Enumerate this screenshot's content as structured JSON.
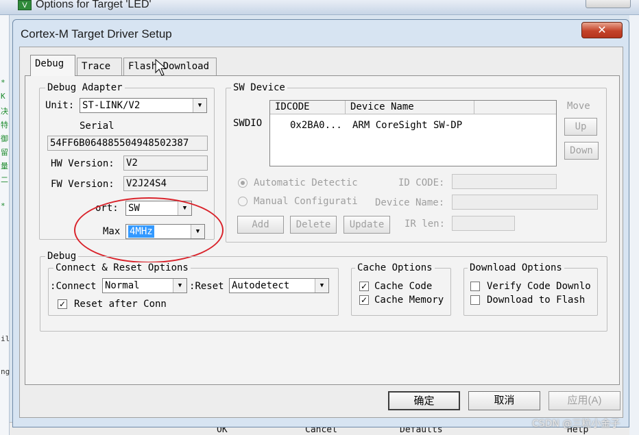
{
  "outer_window": {
    "title": "Options for Target 'LED'",
    "close_glyph": "✕",
    "side_marks": [
      "*",
      "K",
      "决",
      "特",
      "御",
      "留",
      "量",
      "二",
      "*"
    ],
    "bottom_buttons": {
      "ok": "OK",
      "cancel": "Cancel",
      "defaults": "Defaults",
      "help": "Help"
    },
    "left_fragments": [
      "il",
      "ng"
    ]
  },
  "dialog": {
    "title": "Cortex-M Target Driver Setup",
    "close_glyph": "✕",
    "tabs": [
      {
        "label": "Debug",
        "active": true
      },
      {
        "label": "Trace",
        "active": false
      },
      {
        "label": "Flash Download",
        "active": false
      }
    ]
  },
  "debug_adapter": {
    "group_label": "Debug Adapter",
    "unit_label": "Unit:",
    "unit_value": "ST-LINK/V2",
    "serial_label": "Serial",
    "serial_value": "54FF6B064885504948502387",
    "hw_label": "HW Version:",
    "hw_value": "V2",
    "fw_label": "FW Version:",
    "fw_value": "V2J24S4",
    "port_label": "ort:",
    "port_value": "SW",
    "max_label": "Max",
    "max_value": "4MHz"
  },
  "sw_device": {
    "group_label": "SW Device",
    "swdio_label": "SWDIO",
    "columns": [
      "IDCODE",
      "Device Name"
    ],
    "rows": [
      {
        "idcode": "0x2BA0...",
        "device_name": "ARM CoreSight SW-DP"
      }
    ],
    "move_label": "Move",
    "up_label": "Up",
    "down_label": "Down",
    "automatic_label": "Automatic Detectic",
    "manual_label": "Manual Configurati",
    "id_code_label": "ID CODE:",
    "device_name_label": "Device Name:",
    "ir_len_label": "IR len:",
    "add_label": "Add",
    "delete_label": "Delete",
    "update_label": "Update"
  },
  "debug_group": {
    "group_label": "Debug",
    "connect_reset": {
      "group_label": "Connect & Reset Options",
      "connect_label": "Connect:",
      "connect_value": "Normal",
      "reset_label": "Reset:",
      "reset_value": "Autodetect",
      "reset_after_label": "Reset after Conn",
      "reset_after_checked": true
    },
    "cache": {
      "group_label": "Cache Options",
      "cache_code_label": "Cache Code",
      "cache_code_checked": true,
      "cache_memory_label": "Cache Memory",
      "cache_memory_checked": true
    },
    "download": {
      "group_label": "Download Options",
      "verify_label": "Verify Code Downlo",
      "verify_checked": false,
      "download_flash_label": "Download to Flash",
      "download_flash_checked": false
    }
  },
  "footer_buttons": {
    "ok": "确定",
    "cancel": "取消",
    "apply": "应用(A)"
  },
  "check_glyph": "✓",
  "dropdown_glyph": "▼",
  "watermark": "CSDN @三粒小金子",
  "colors": {
    "annotation": "#d9232b",
    "selection": "#3399ff",
    "close_button": "#c4432a"
  }
}
